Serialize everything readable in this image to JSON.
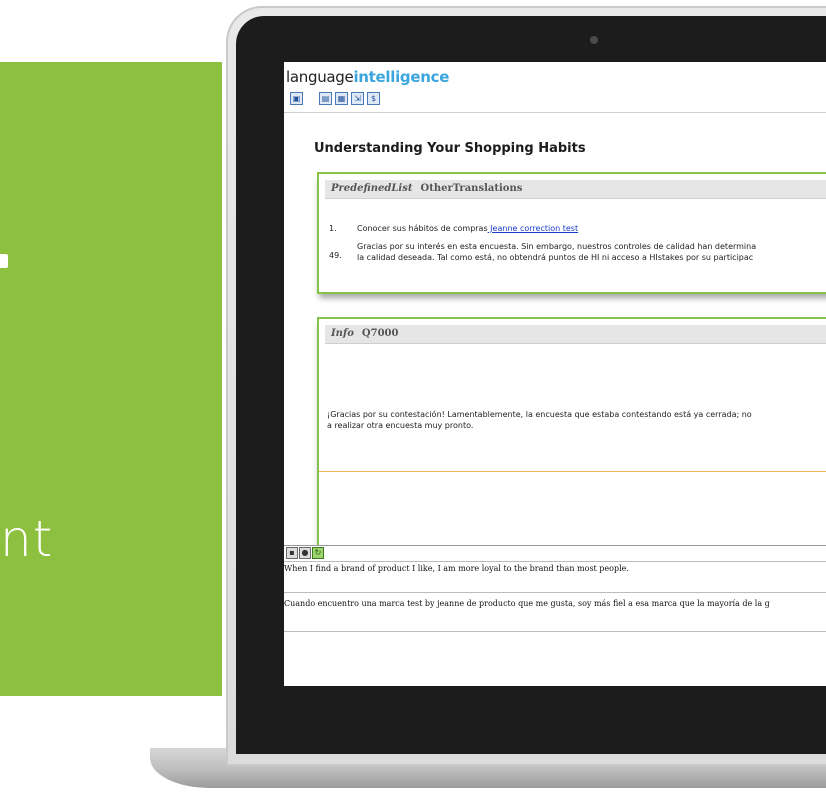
{
  "promo": {
    "text": "nt"
  },
  "app": {
    "logo_main": "language",
    "logo_accent": "intelligence",
    "toolbar": [
      {
        "icon": "save-icon",
        "glyph": "▣"
      },
      {
        "icon": "document-icon",
        "glyph": "▤"
      },
      {
        "icon": "grid-icon",
        "glyph": "▦"
      },
      {
        "icon": "export-icon",
        "glyph": "⇲"
      },
      {
        "icon": "currency-icon",
        "glyph": "$"
      }
    ]
  },
  "page": {
    "title": "Understanding Your Shopping Habits"
  },
  "card1": {
    "type": "PredefinedList",
    "name": "OtherTranslations",
    "items": [
      {
        "num": "1.",
        "text": "Conocer sus hábitos de compras",
        "link": " Jeanne correction test"
      },
      {
        "num": "49.",
        "line1": "Gracias por su interés en esta encuesta. Sin embargo, nuestros controles de calidad han determina",
        "line2": "la calidad deseada. Tal como está, no obtendrá puntos de HI ni acceso a HIstakes por su participac"
      }
    ]
  },
  "card2": {
    "type": "Info",
    "name": "Q7000",
    "line1": "¡Gracias por su contestación! Lamentablemente, la encuesta que estaba contestando está ya cerrada; no",
    "line2": "a realizar otra encuesta muy pronto."
  },
  "editor": {
    "source": "When I find a brand of product I like, I am more loyal to the brand than most people.",
    "target": "Cuando encuentro una marca test by jeanne de producto que me gusta, soy más  fiel  a esa marca que la mayoría de la g"
  },
  "colors": {
    "promo_green": "#8dc03f",
    "card_border": "#87c34a",
    "logo_accent": "#3aa6dd",
    "link": "#1a3cc8"
  }
}
